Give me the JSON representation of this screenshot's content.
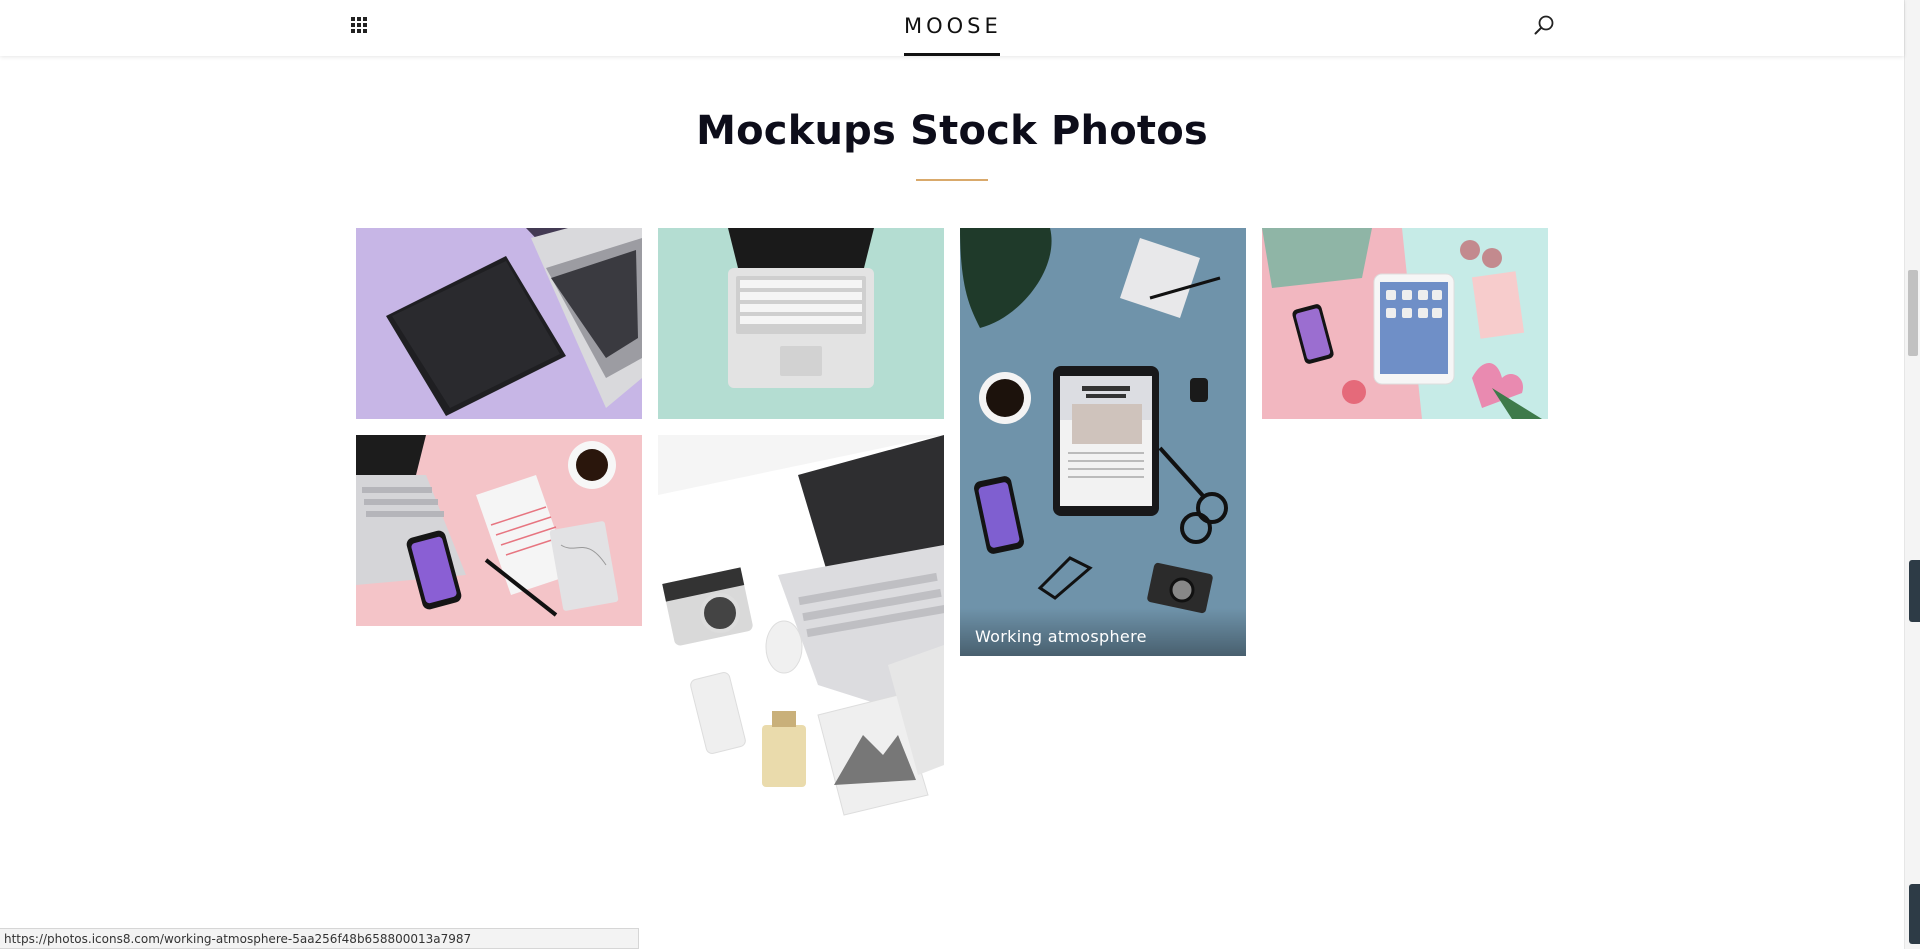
{
  "header": {
    "logo": "MOOSE",
    "menu_icon": "grid-menu-icon",
    "search_icon": "search-icon"
  },
  "page": {
    "title": "Mockups Stock Photos",
    "accent_color": "#d9a96b"
  },
  "photos": [
    {
      "alt": "tablet and laptop on purple background",
      "caption": ""
    },
    {
      "alt": "laptop on mint background",
      "caption": ""
    },
    {
      "alt": "tablet, phone, camera and coffee on blue background",
      "caption": "Working atmosphere"
    },
    {
      "alt": "tablet, phone and flowers on pink and mint background",
      "caption": ""
    },
    {
      "alt": "laptop, phone, notebook and coffee on pink background",
      "caption": ""
    },
    {
      "alt": "laptop, camera, phone and perfume on white background",
      "caption": ""
    }
  ],
  "status_bar": {
    "url": "https://photos.icons8.com/working-atmosphere-5aa256f48b658800013a7987"
  }
}
